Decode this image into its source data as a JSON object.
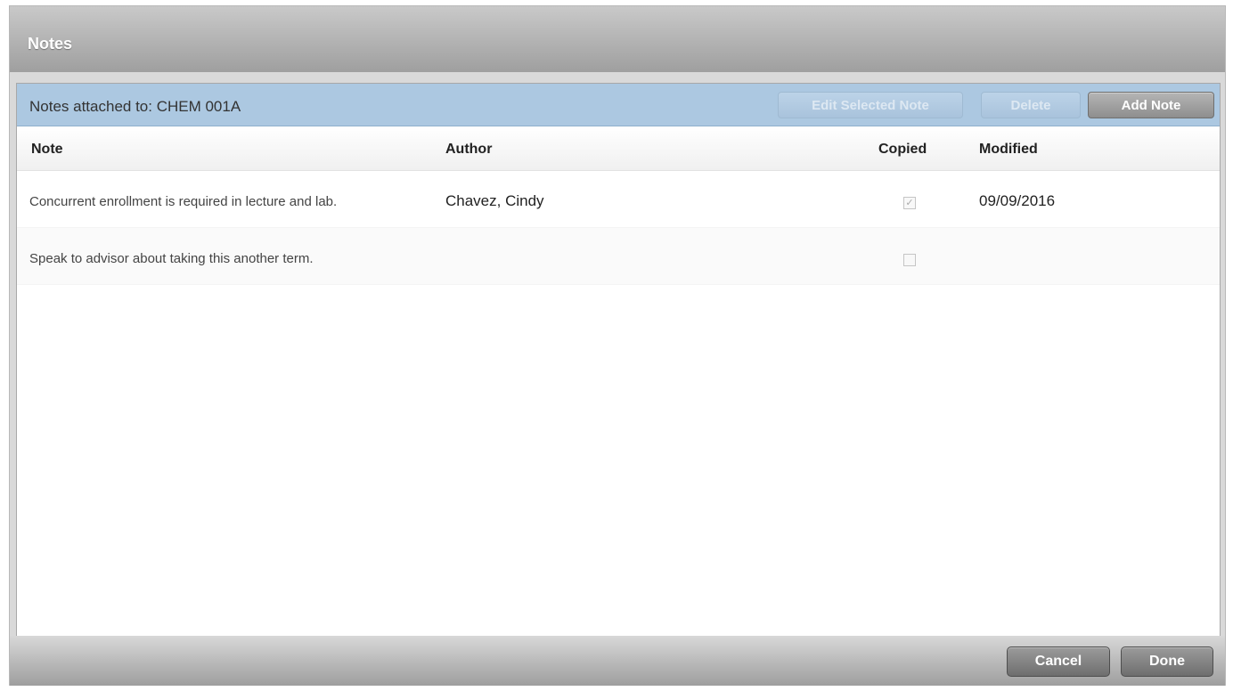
{
  "dialog": {
    "title": "Notes"
  },
  "toolbar": {
    "attached_label": "Notes attached to:  CHEM 001A",
    "edit_label": "Edit Selected Note",
    "delete_label": "Delete",
    "add_label": "Add Note"
  },
  "grid": {
    "columns": {
      "note": "Note",
      "author": "Author",
      "copied": "Copied",
      "modified": "Modified"
    },
    "rows": [
      {
        "note": "Concurrent enrollment is required in lecture and lab.",
        "author": "Chavez, Cindy",
        "copied": true,
        "modified": "09/09/2016"
      },
      {
        "note": "Speak to advisor about taking this another term.",
        "author": "",
        "copied": false,
        "modified": ""
      }
    ]
  },
  "footer": {
    "cancel_label": "Cancel",
    "done_label": "Done"
  },
  "colors": {
    "toolbar_bg": "#acc8e1",
    "title_bar": "#b0b0b0",
    "button_dark": "#7a7a7a"
  }
}
